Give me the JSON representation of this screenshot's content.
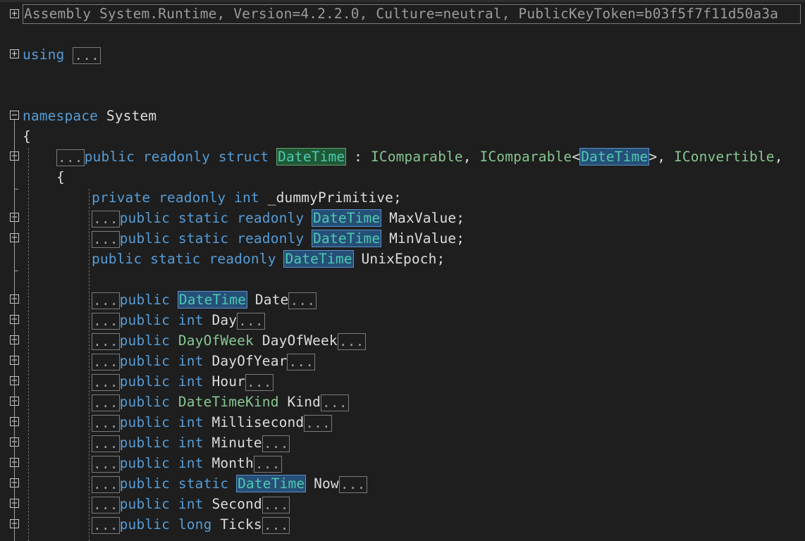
{
  "assembly_line": "Assembly System.Runtime, Version=4.2.2.0, Culture=neutral, PublicKeyToken=b03f5f7f11d50a3a",
  "collapsed_marker": "...",
  "usings": {
    "kw": "using"
  },
  "namespace": {
    "kw": "namespace",
    "name": "System"
  },
  "brace_open": "{",
  "struct_decl": {
    "public": "public",
    "readonly": "readonly",
    "struct": "struct",
    "name": "DateTime",
    "colon": " : ",
    "iface1": "IComparable",
    "comma1": ", ",
    "iface2": "IComparable",
    "lt": "<",
    "gen": "DateTime",
    "gt": ">",
    "comma2": ", ",
    "iface3": "IConvertible",
    "comma3": ","
  },
  "field_private": {
    "private": "private",
    "readonly": "readonly",
    "int": "int",
    "name": "_dummyPrimitive;"
  },
  "fields": [
    {
      "mods": "public static readonly",
      "type": "DateTime",
      "name": "MaxValue;"
    },
    {
      "mods": "public static readonly",
      "type": "DateTime",
      "name": "MinValue;"
    },
    {
      "mods": "public static readonly",
      "type": "DateTime",
      "name": "UnixEpoch;"
    }
  ],
  "properties": [
    {
      "mods": "public",
      "type": "DateTime",
      "name": "Date"
    },
    {
      "mods": "public",
      "type": "int",
      "name": "Day"
    },
    {
      "mods": "public",
      "type": "DayOfWeek",
      "name": "DayOfWeek"
    },
    {
      "mods": "public",
      "type": "int",
      "name": "DayOfYear"
    },
    {
      "mods": "public",
      "type": "int",
      "name": "Hour"
    },
    {
      "mods": "public",
      "type": "DateTimeKind",
      "name": "Kind"
    },
    {
      "mods": "public",
      "type": "int",
      "name": "Millisecond"
    },
    {
      "mods": "public",
      "type": "int",
      "name": "Minute"
    },
    {
      "mods": "public",
      "type": "int",
      "name": "Month"
    },
    {
      "mods": "public static",
      "type": "DateTime",
      "name": "Now"
    },
    {
      "mods": "public",
      "type": "int",
      "name": "Second"
    },
    {
      "mods": "public",
      "type": "long",
      "name": "Ticks"
    }
  ],
  "colors": {
    "keyword": "#569cd6",
    "type": "#4ec9b0",
    "struct_type": "#86c691",
    "background": "#1e1e1e"
  }
}
